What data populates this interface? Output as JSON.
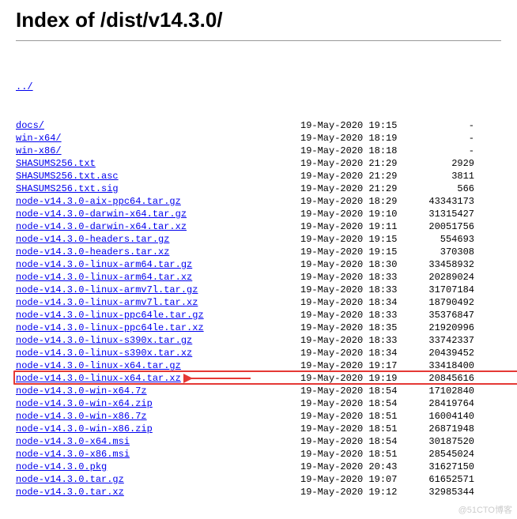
{
  "title": "Index of /dist/v14.3.0/",
  "parent_link": "../",
  "files": [
    {
      "name": "docs/",
      "date": "19-May-2020 19:15",
      "size": "-"
    },
    {
      "name": "win-x64/",
      "date": "19-May-2020 18:19",
      "size": "-"
    },
    {
      "name": "win-x86/",
      "date": "19-May-2020 18:18",
      "size": "-"
    },
    {
      "name": "SHASUMS256.txt",
      "date": "19-May-2020 21:29",
      "size": "2929"
    },
    {
      "name": "SHASUMS256.txt.asc",
      "date": "19-May-2020 21:29",
      "size": "3811"
    },
    {
      "name": "SHASUMS256.txt.sig",
      "date": "19-May-2020 21:29",
      "size": "566"
    },
    {
      "name": "node-v14.3.0-aix-ppc64.tar.gz",
      "date": "19-May-2020 18:29",
      "size": "43343173"
    },
    {
      "name": "node-v14.3.0-darwin-x64.tar.gz",
      "date": "19-May-2020 19:10",
      "size": "31315427"
    },
    {
      "name": "node-v14.3.0-darwin-x64.tar.xz",
      "date": "19-May-2020 19:11",
      "size": "20051756"
    },
    {
      "name": "node-v14.3.0-headers.tar.gz",
      "date": "19-May-2020 19:15",
      "size": "554693"
    },
    {
      "name": "node-v14.3.0-headers.tar.xz",
      "date": "19-May-2020 19:15",
      "size": "370308"
    },
    {
      "name": "node-v14.3.0-linux-arm64.tar.gz",
      "date": "19-May-2020 18:30",
      "size": "33458932"
    },
    {
      "name": "node-v14.3.0-linux-arm64.tar.xz",
      "date": "19-May-2020 18:33",
      "size": "20289024"
    },
    {
      "name": "node-v14.3.0-linux-armv7l.tar.gz",
      "date": "19-May-2020 18:33",
      "size": "31707184"
    },
    {
      "name": "node-v14.3.0-linux-armv7l.tar.xz",
      "date": "19-May-2020 18:34",
      "size": "18790492"
    },
    {
      "name": "node-v14.3.0-linux-ppc64le.tar.gz",
      "date": "19-May-2020 18:33",
      "size": "35376847"
    },
    {
      "name": "node-v14.3.0-linux-ppc64le.tar.xz",
      "date": "19-May-2020 18:35",
      "size": "21920996"
    },
    {
      "name": "node-v14.3.0-linux-s390x.tar.gz",
      "date": "19-May-2020 18:33",
      "size": "33742337"
    },
    {
      "name": "node-v14.3.0-linux-s390x.tar.xz",
      "date": "19-May-2020 18:34",
      "size": "20439452"
    },
    {
      "name": "node-v14.3.0-linux-x64.tar.gz",
      "date": "19-May-2020 19:17",
      "size": "33418400"
    },
    {
      "name": "node-v14.3.0-linux-x64.tar.xz",
      "date": "19-May-2020 19:19",
      "size": "20845616",
      "highlighted": true
    },
    {
      "name": "node-v14.3.0-win-x64.7z",
      "date": "19-May-2020 18:54",
      "size": "17102840"
    },
    {
      "name": "node-v14.3.0-win-x64.zip",
      "date": "19-May-2020 18:54",
      "size": "28419764"
    },
    {
      "name": "node-v14.3.0-win-x86.7z",
      "date": "19-May-2020 18:51",
      "size": "16004140"
    },
    {
      "name": "node-v14.3.0-win-x86.zip",
      "date": "19-May-2020 18:51",
      "size": "26871948"
    },
    {
      "name": "node-v14.3.0-x64.msi",
      "date": "19-May-2020 18:54",
      "size": "30187520"
    },
    {
      "name": "node-v14.3.0-x86.msi",
      "date": "19-May-2020 18:51",
      "size": "28545024"
    },
    {
      "name": "node-v14.3.0.pkg",
      "date": "19-May-2020 20:43",
      "size": "31627150"
    },
    {
      "name": "node-v14.3.0.tar.gz",
      "date": "19-May-2020 19:07",
      "size": "61652571"
    },
    {
      "name": "node-v14.3.0.tar.xz",
      "date": "19-May-2020 19:12",
      "size": "32985344"
    }
  ],
  "watermark": "@51CTO博客"
}
